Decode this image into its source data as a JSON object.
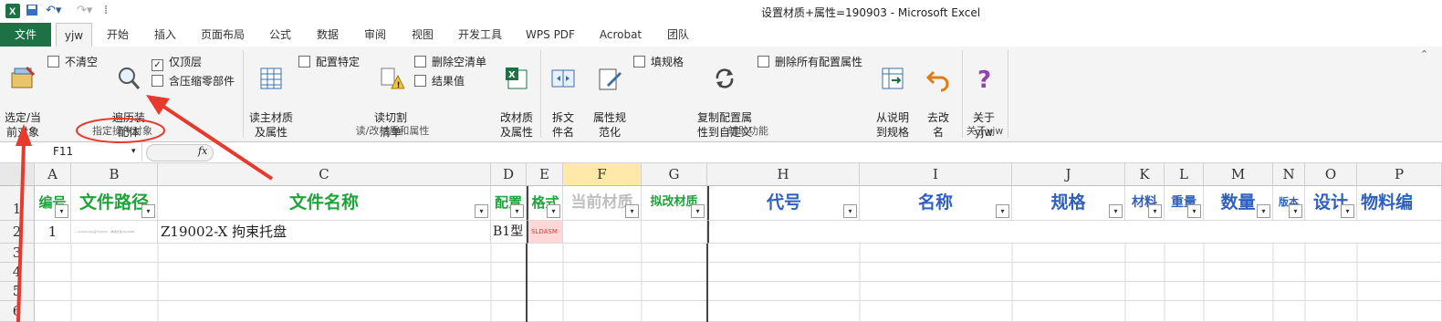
{
  "window": {
    "title": "设置材质+属性=190903  -  Microsoft Excel"
  },
  "menu": {
    "file": "文件",
    "tabs": [
      "yjw",
      "开始",
      "插入",
      "页面布局",
      "公式",
      "数据",
      "审阅",
      "视图",
      "开发工具",
      "WPS PDF",
      "Acrobat",
      "团队"
    ]
  },
  "ribbon": {
    "select_current": "选定/当\n前对象",
    "not_clear": "不清空",
    "traverse_parts": "遍历装\n配体",
    "top_only": "仅顶层",
    "include_zero": "含压缩零部件",
    "group_target": "指定操作对象",
    "read_material": "读主材质\n及属性",
    "config_specific": "配置特定",
    "read_cut_list": "读切割\n清单",
    "delete_empty_list": "删除空清单",
    "result_value": "结果值",
    "change_material": "改材质\n及属性",
    "group_material": "读/改材质和属性",
    "split_filename": "拆文\n件名",
    "prop_normalize": "属性规\n范化",
    "fill_spec": "填规格",
    "copy_config": "复制配置属\n性到自定义",
    "delete_all_config": "删除所有配置属性",
    "group_aux": "辅助功能",
    "from_desc": "从说明\n到规格",
    "rename": "去改\n名",
    "about": "关于\nyjw",
    "group_about": "关于yjw"
  },
  "formula_bar": {
    "name_box": "F11",
    "fx": "fx"
  },
  "columns": [
    "A",
    "B",
    "C",
    "D",
    "E",
    "F",
    "G",
    "H",
    "I",
    "J",
    "K",
    "L",
    "M",
    "N",
    "O",
    "P"
  ],
  "rows": [
    "1",
    "2",
    "3",
    "4",
    "5",
    "6"
  ],
  "header_row": [
    "编号",
    "文件路径",
    "文件名称",
    "配置",
    "格式",
    "当前材质",
    "拟改材质",
    "代号",
    "名称",
    "规格",
    "材料",
    "重量",
    "数量",
    "版本",
    "设计",
    "物料编"
  ],
  "data_row": {
    "A": "1",
    "B": "~ \\solidworks\\设计\\2019\\...\\拘束托盘.SLDASM",
    "C": "Z19002-X 拘束托盘",
    "D": "B1型",
    "E": "SLDASM"
  },
  "colors": {
    "excel_green": "#1e7145",
    "header_green": "#1ea33a",
    "header_blue": "#2f5fbf",
    "annotation_red": "#e8392d"
  }
}
